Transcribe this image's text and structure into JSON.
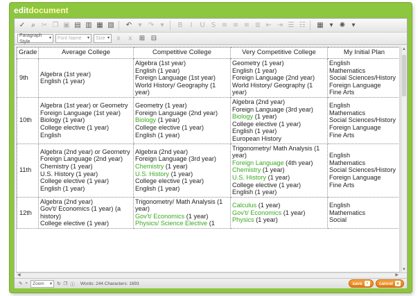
{
  "title": {
    "part1": "edit",
    "part2": "document"
  },
  "toolbar": {
    "icons": [
      "spellcheck-icon",
      "find-icon",
      "cut-icon",
      "copy-icon",
      "paste-icon",
      "paste-text-icon",
      "paste-word-icon",
      "print-icon",
      "undo-icon",
      "redo-icon",
      "bold-icon",
      "italic-icon",
      "underline-icon",
      "strikethrough-icon",
      "align-left-icon",
      "align-center-icon",
      "align-right-icon",
      "justify-icon",
      "outdent-icon",
      "indent-icon",
      "bullet-list-icon",
      "number-list-icon",
      "table-icon",
      "more-icon"
    ]
  },
  "format_bar": {
    "paragraph_style": "Paragraph Style",
    "font_name": "Font Name",
    "size": "Size"
  },
  "table": {
    "headers": [
      "Grade",
      "Average College",
      "Competitive College",
      "Very Competitive College",
      "My Initial Plan"
    ],
    "rows": [
      {
        "grade": "9th",
        "average": [
          {
            "t": "Algebra (1st year)"
          },
          {
            "t": "English (1 year)"
          }
        ],
        "competitive": [
          {
            "t": "Algebra (1st year)"
          },
          {
            "t": "English (1 year)"
          },
          {
            "t": "Foreign Language (1st year)"
          },
          {
            "t": "World History/ Geography (1 year)"
          }
        ],
        "very": [
          {
            "t": "Geometry (1 year)"
          },
          {
            "t": "English (1 year)"
          },
          {
            "t": "Foreign Language (2nd year)"
          },
          {
            "t": "World History/ Geography (1 year)"
          }
        ],
        "plan": [
          {
            "t": "English"
          },
          {
            "t": "Mathematics"
          },
          {
            "t": "Social Sciences/History"
          },
          {
            "t": "Foreign Language"
          },
          {
            "t": "Fine Arts"
          }
        ]
      },
      {
        "grade": "10th",
        "average": [
          {
            "t": "Algebra (1st year) or Geometry"
          },
          {
            "t": "Foreign Language (1st year)"
          },
          {
            "t": "Biology (1 year)"
          },
          {
            "t": "College elective (1 year)"
          },
          {
            "t": "English"
          }
        ],
        "competitive": [
          {
            "t": "Geometry (1 year)"
          },
          {
            "t": "Foreign Language (2nd year)"
          },
          {
            "t": "Biology (1 year)",
            "green": "Biology"
          },
          {
            "t": "College elective (1 year)"
          },
          {
            "t": "English (1 year)"
          }
        ],
        "very": [
          {
            "t": "Algebra (2nd year)"
          },
          {
            "t": "Foreign Language (3rd year)"
          },
          {
            "t": "Biology (1 year)",
            "green": "Biology"
          },
          {
            "t": "College elective (1 year)"
          },
          {
            "t": "English (1 year)"
          },
          {
            "t": "European History"
          }
        ],
        "plan": [
          {
            "t": "English"
          },
          {
            "t": "Mathematics"
          },
          {
            "t": "Social Sciences/History"
          },
          {
            "t": "Foreign Language"
          },
          {
            "t": "Fine Arts"
          }
        ]
      },
      {
        "grade": "11th",
        "average": [
          {
            "t": "Algebra (2nd year) or Geometry"
          },
          {
            "t": "Foreign Language (2nd year)"
          },
          {
            "t": "Chemistry (1 year)"
          },
          {
            "t": "U.S. History (1 year)"
          },
          {
            "t": "College elective (1 year)"
          },
          {
            "t": "English (1 year)"
          }
        ],
        "competitive": [
          {
            "t": "Algebra (2nd year)"
          },
          {
            "t": "Foreign Language (3rd year)"
          },
          {
            "t": "Chemistry (1 year)",
            "green": "Chemistry"
          },
          {
            "t": "U.S. History (1 year)",
            "green": "U.S. History"
          },
          {
            "t": "College elective (1 year)"
          },
          {
            "t": "English (1 year)"
          }
        ],
        "very": [
          {
            "t": "Trigonometry/ Math Analysis (1 year)"
          },
          {
            "t": "Foreign Language (4th year)",
            "green": "Foreign Language"
          },
          {
            "t": "Chemistry (1 year)",
            "green": "Chemistry"
          },
          {
            "t": "U.S. History (1 year)",
            "green": "U.S. History"
          },
          {
            "t": "College elective (1 year)"
          },
          {
            "t": "English (1 year)"
          }
        ],
        "plan": [
          {
            "t": "English"
          },
          {
            "t": "Mathematics"
          },
          {
            "t": "Social Sciences/History"
          },
          {
            "t": "Foreign Language"
          },
          {
            "t": "Fine Arts"
          }
        ]
      },
      {
        "grade": "12th",
        "average": [
          {
            "t": "Algebra (2nd year)"
          },
          {
            "t": "Gov't/ Economics (1 year) (a history)"
          },
          {
            "t": "College elective (1 year)"
          }
        ],
        "competitive": [
          {
            "t": "Trigonometry/ Math Analysis (1 year)"
          },
          {
            "t": "Gov't/ Economics (1 year)",
            "green": "Gov't/ Economics"
          },
          {
            "t": "Physics/ Science Elective (1",
            "green": "Physics/ Science Elective"
          }
        ],
        "very": [
          {
            "t": "Calculus (1 year)",
            "green": "Calculus"
          },
          {
            "t": "Gov't/ Economics (1 year)",
            "green": "Gov't/ Economics"
          },
          {
            "t": "Physics (1 year)",
            "green": "Physics"
          }
        ],
        "plan": [
          {
            "t": "English"
          },
          {
            "t": "Mathematics"
          },
          {
            "t": "Social"
          }
        ]
      }
    ]
  },
  "statusbar": {
    "zoom": "Zoom",
    "word_count": "Words: 244 Characters: 1693",
    "save_label": "save",
    "cancel_label": "cancel"
  },
  "colors": {
    "frame": "#8dc63f",
    "highlight_text": "#3aa820",
    "button": "#e8891c"
  }
}
